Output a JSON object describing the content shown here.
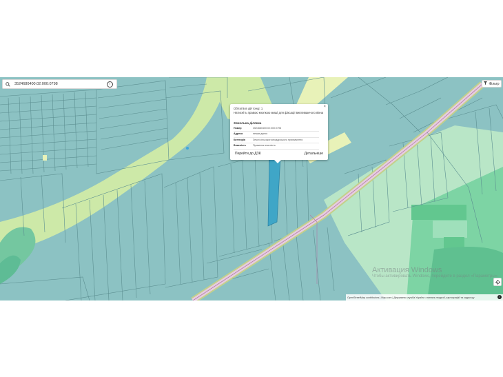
{
  "search": {
    "value": "3524680400:02:000:0798"
  },
  "filter": {
    "label": "Фільтр"
  },
  "popup": {
    "line1": "Об'єктів в цій точці: 1",
    "line2": "Натисніть правою кнопкою миші для фіксації випливаючого вікна",
    "section_title": "Земельна ділянка",
    "rows": [
      {
        "key": "Номер",
        "value": "3524680400:02:000:0798"
      },
      {
        "key": "Адреса",
        "value": "немає даних"
      },
      {
        "key": "Категорія",
        "value": "Землі сільськогосподарського призначення"
      },
      {
        "key": "Власність",
        "value": "Приватна власність"
      }
    ],
    "action_left": "Перейти до ДЗК",
    "action_right": "Детальніше"
  },
  "attribution": "OpenStreetMap contributors | Map.com | Державна служба України з питань геодезії, картографії та кадастру",
  "watermark": {
    "line1": "Активация Windows",
    "line2": "Чтобы активировать Windows, перейдите в раздел «Параметры»."
  },
  "colors": {
    "parcel": "#8cc2c3",
    "parcel_line": "#5c8f91",
    "meadow": "#cde9a8",
    "green_zone": "#7dd4a4",
    "selected": "#3fa6c7",
    "road": "#e6cde0"
  },
  "icons": {
    "search": "search-icon",
    "info": "info-icon",
    "filter": "filter-icon",
    "close": "close-icon",
    "locate": "locate-icon"
  }
}
